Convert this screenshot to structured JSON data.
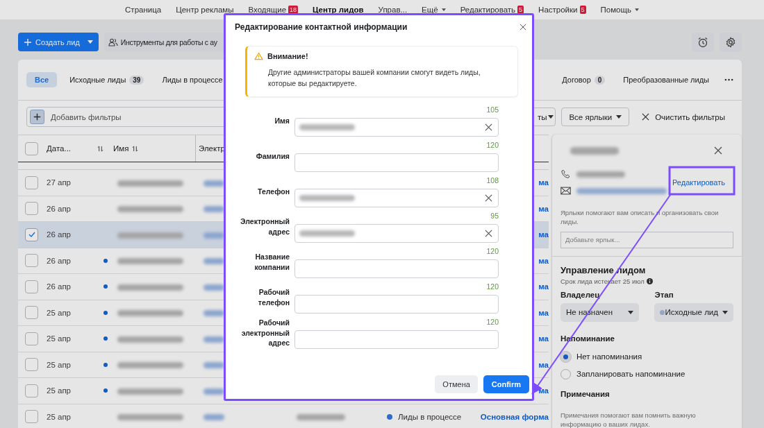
{
  "top_nav": [
    {
      "label": "Страница",
      "selected": false
    },
    {
      "label": "Центр рекламы",
      "selected": false
    },
    {
      "label": "Входящие",
      "badge": "18",
      "selected": false
    },
    {
      "label": "Центр лидов",
      "selected": true
    },
    {
      "label": "Управ...",
      "selected": false
    },
    {
      "label": "Ещё",
      "has_menu": true,
      "selected": false
    },
    {
      "label": "Редактировать",
      "badge": "5",
      "selected": false
    },
    {
      "label": "Настройки",
      "badge": "5",
      "selected": false
    },
    {
      "label": "Помощь",
      "has_menu": true,
      "selected": false
    }
  ],
  "toolbar": {
    "create_button": "Создать лид",
    "tools_button": "Инструменты для работы с ау"
  },
  "stage_tabs": [
    {
      "label": "Все",
      "selected": true
    },
    {
      "label": "Исходные лиды",
      "count": "39",
      "selected": false
    },
    {
      "label": "Лиды в процессе",
      "selected": false
    },
    {
      "label": "Договор",
      "count": "0",
      "selected": false
    },
    {
      "label": "Преобразованные лиды",
      "selected": false
    }
  ],
  "filters": {
    "add_filter": "Добавить фильтры",
    "dropdowns": [
      "ты",
      "Все ярлыки"
    ],
    "clear": "Очистить фильтры"
  },
  "table": {
    "all_selected": false,
    "columns": [
      {
        "label": "Дата...",
        "sortable": true
      },
      {
        "label": "Имя",
        "sortable": true
      },
      {
        "label": "Электр",
        "sortable": false
      }
    ],
    "rows": [
      {
        "date": "27 апр",
        "unread": false,
        "selected": false,
        "form": "ма"
      },
      {
        "date": "26 апр",
        "unread": false,
        "selected": false,
        "form": "ма"
      },
      {
        "date": "26 апр",
        "unread": false,
        "selected": true,
        "form": "ма"
      },
      {
        "date": "26 апр",
        "unread": true,
        "selected": false,
        "form": "ма"
      },
      {
        "date": "26 апр",
        "unread": true,
        "selected": false,
        "form": "ма"
      },
      {
        "date": "25 апр",
        "unread": true,
        "selected": false,
        "form": "ма"
      },
      {
        "date": "25 апр",
        "unread": true,
        "selected": false,
        "form": "ма"
      },
      {
        "date": "25 апр",
        "unread": true,
        "selected": false,
        "form": "ма"
      },
      {
        "date": "25 апр",
        "unread": true,
        "selected": false,
        "form": "ма"
      },
      {
        "date": "25 апр",
        "unread": false,
        "selected": false,
        "stage": "Лиды в процессе",
        "form": "Основная форма"
      }
    ]
  },
  "detail": {
    "edit_link": "Редактировать",
    "tags_hint": "Ярлыки помогают вам описать и организовать свои лиды.",
    "tag_placeholder": "Добавьте ярлык...",
    "manage_title": "Управление лидом",
    "expiry": "Срок лида истекает 25 июл",
    "owner_label": "Владелец",
    "owner_value": "Не назначен",
    "stage_label": "Этап",
    "stage_value": "Исходные лид",
    "reminder_title": "Напоминание",
    "reminder_options": [
      {
        "label": "Нет напоминания",
        "selected": true
      },
      {
        "label": "Запланировать напоминание",
        "selected": false
      }
    ],
    "notes_title": "Примечания",
    "notes_hint": "Примечания помогают вам помнить важную информацию о ваших лидах."
  },
  "modal": {
    "title": "Редактирование контактной информации",
    "warning": {
      "title": "Внимание!",
      "text": "Другие администраторы вашей компании смогут видеть лиды, которые вы редактируете."
    },
    "fields": [
      {
        "label": "Имя",
        "counter": "105",
        "filled": true
      },
      {
        "label": "Фамилия",
        "counter": "120",
        "filled": false
      },
      {
        "label": "Телефон",
        "counter": "108",
        "filled": true
      },
      {
        "label": "Электронный адрес",
        "counter": "95",
        "filled": true
      },
      {
        "label": "Название компании",
        "counter": "120",
        "filled": false
      },
      {
        "label": "Рабочий телефон",
        "counter": "120",
        "filled": false
      },
      {
        "label": "Рабочий электронный адрес",
        "counter": "120",
        "filled": false
      }
    ],
    "cancel": "Отмена",
    "confirm": "Confirm"
  }
}
